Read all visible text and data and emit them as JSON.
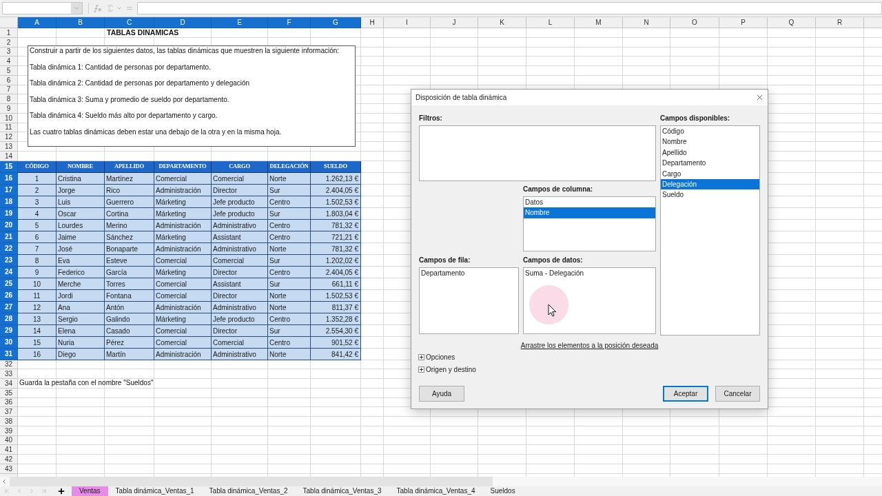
{
  "columns": [
    {
      "label": "A",
      "selected": true
    },
    {
      "label": "B",
      "selected": true
    },
    {
      "label": "C",
      "selected": true
    },
    {
      "label": "D",
      "selected": true
    },
    {
      "label": "E",
      "selected": true
    },
    {
      "label": "F",
      "selected": true
    },
    {
      "label": "G",
      "selected": true
    },
    {
      "label": "H",
      "selected": false
    },
    {
      "label": "I",
      "selected": false
    },
    {
      "label": "J",
      "selected": false
    },
    {
      "label": "K",
      "selected": false
    },
    {
      "label": "L",
      "selected": false
    },
    {
      "label": "M",
      "selected": false
    },
    {
      "label": "N",
      "selected": false
    },
    {
      "label": "O",
      "selected": false
    },
    {
      "label": "P",
      "selected": false
    },
    {
      "label": "Q",
      "selected": false
    },
    {
      "label": "R",
      "selected": false
    }
  ],
  "rows": [
    {
      "label": "1",
      "selected": false
    },
    {
      "label": "2",
      "selected": false
    },
    {
      "label": "3",
      "selected": false
    },
    {
      "label": "4",
      "selected": false
    },
    {
      "label": "5",
      "selected": false
    },
    {
      "label": "6",
      "selected": false
    },
    {
      "label": "7",
      "selected": false
    },
    {
      "label": "8",
      "selected": false
    },
    {
      "label": "9",
      "selected": false
    },
    {
      "label": "10",
      "selected": false
    },
    {
      "label": "11",
      "selected": false
    },
    {
      "label": "12",
      "selected": false
    },
    {
      "label": "13",
      "selected": false
    },
    {
      "label": "14",
      "selected": false
    },
    {
      "label": "15",
      "selected": true
    },
    {
      "label": "16",
      "selected": true
    },
    {
      "label": "17",
      "selected": true
    },
    {
      "label": "18",
      "selected": true
    },
    {
      "label": "19",
      "selected": true
    },
    {
      "label": "20",
      "selected": true
    },
    {
      "label": "21",
      "selected": true
    },
    {
      "label": "22",
      "selected": true
    },
    {
      "label": "23",
      "selected": true
    },
    {
      "label": "24",
      "selected": true
    },
    {
      "label": "25",
      "selected": true
    },
    {
      "label": "26",
      "selected": true
    },
    {
      "label": "27",
      "selected": true
    },
    {
      "label": "28",
      "selected": true
    },
    {
      "label": "29",
      "selected": true
    },
    {
      "label": "30",
      "selected": true
    },
    {
      "label": "31",
      "selected": true
    },
    {
      "label": "32",
      "selected": false
    },
    {
      "label": "33",
      "selected": false
    },
    {
      "label": "34",
      "selected": false
    },
    {
      "label": "35",
      "selected": false
    },
    {
      "label": "36",
      "selected": false
    },
    {
      "label": "37",
      "selected": false
    },
    {
      "label": "38",
      "selected": false
    },
    {
      "label": "39",
      "selected": false
    },
    {
      "label": "40",
      "selected": false
    },
    {
      "label": "41",
      "selected": false
    },
    {
      "label": "42",
      "selected": false
    },
    {
      "label": "43",
      "selected": false
    }
  ],
  "title": "TABLAS DINAMICAS",
  "instructions": [
    "Construir a partir de los siguientes datos, las tablas dinámicas que muestren la siguiente información:",
    "Tabla dinámica 1: Cantidad de personas por departamento.",
    "Tabla dinámica 2: Cantidad de personas por departamento y delegación",
    "Tabla dinámica 3:  Suma y promedio de sueldo por departamento.",
    "Tabla dinámica 4: Sueldo más alto por departamento y cargo.",
    "Las cuatro tablas dinámicas deben estar una debajo de la otra y en la misma hoja."
  ],
  "table": {
    "columns": [
      "CÓDIGO",
      "NOMBRE",
      "APELLIDO",
      "DEPARTAMENTO",
      "CARGO",
      "DELEGACIÓN",
      "SUELDO"
    ],
    "rows": [
      [
        "1",
        "Cristina",
        "Martínez",
        "Comercial",
        "Comercial",
        "Norte",
        "1.262,13 €"
      ],
      [
        "2",
        "Jorge",
        "Rico",
        "Administración",
        "Director",
        "Sur",
        "2.404,05 €"
      ],
      [
        "3",
        "Luis",
        "Guerrero",
        "Márketing",
        "Jefe producto",
        "Centro",
        "1.502,53 €"
      ],
      [
        "4",
        "Oscar",
        "Cortina",
        "Márketing",
        "Jefe producto",
        "Sur",
        "1.803,04 €"
      ],
      [
        "5",
        "Lourdes",
        "Merino",
        "Administración",
        "Administrativo",
        "Centro",
        "781,32 €"
      ],
      [
        "6",
        "Jaime",
        "Sánchez",
        "Márketing",
        "Assistant",
        "Centro",
        "721,21 €"
      ],
      [
        "7",
        "José",
        "Bonaparte",
        "Administración",
        "Administrativo",
        "Norte",
        "781,32 €"
      ],
      [
        "8",
        "Eva",
        "Esteve",
        "Comercial",
        "Comercial",
        "Sur",
        "1.202,02 €"
      ],
      [
        "9",
        "Federico",
        "García",
        "Márketing",
        "Director",
        "Centro",
        "2.404,05 €"
      ],
      [
        "10",
        "Merche",
        "Torres",
        "Comercial",
        "Assistant",
        "Sur",
        "661,11 €"
      ],
      [
        "11",
        "Jordi",
        "Fontana",
        "Comercial",
        "Director",
        "Norte",
        "1.502,53 €"
      ],
      [
        "12",
        "Ana",
        "Antón",
        "Administración",
        "Administrativo",
        "Norte",
        "811,37 €"
      ],
      [
        "13",
        "Sergio",
        "Galindo",
        "Márketing",
        "Jefe producto",
        "Centro",
        "1.352,28 €"
      ],
      [
        "14",
        "Elena",
        "Casado",
        "Comercial",
        "Director",
        "Sur",
        "2.554,30 €"
      ],
      [
        "15",
        "Nuria",
        "Pérez",
        "Comercial",
        "Comercial",
        "Centro",
        "901,52 €"
      ],
      [
        "16",
        "Diego",
        "Martín",
        "Administración",
        "Administrativo",
        "Norte",
        "841,42 €"
      ]
    ]
  },
  "note": "Guarda la pestaña con el nombre \"Sueldos\"",
  "sheet_tabs": [
    {
      "label": "Ventas",
      "selected": true
    },
    {
      "label": "Tabla dinámica_Ventas_1",
      "selected": false
    },
    {
      "label": "Tabla dinámica_Ventas_2",
      "selected": false
    },
    {
      "label": "Tabla dinámica_Ventas_3",
      "selected": false
    },
    {
      "label": "Tabla dinámica_Ventas_4",
      "selected": false
    },
    {
      "label": "Sueldos",
      "selected": false
    }
  ],
  "dialog": {
    "title": "Disposición de tabla dinámica",
    "filters": {
      "label": "Filtros:"
    },
    "available_fields": {
      "label": "Campos disponibles:",
      "items": [
        {
          "label": "Código",
          "selected": false
        },
        {
          "label": "Nombre",
          "selected": false
        },
        {
          "label": "Apellido",
          "selected": false
        },
        {
          "label": "Departamento",
          "selected": false
        },
        {
          "label": "Cargo",
          "selected": false
        },
        {
          "label": "Delegación",
          "selected": true
        },
        {
          "label": "Sueldo",
          "selected": false
        }
      ]
    },
    "column_fields": {
      "label": "Campos de columna:",
      "items": [
        {
          "label": "Datos",
          "selected": false
        },
        {
          "label": "Nombre",
          "selected": true
        }
      ]
    },
    "row_fields": {
      "label": "Campos de fila:",
      "items": [
        {
          "label": "Departamento",
          "selected": false
        }
      ]
    },
    "data_fields": {
      "label": "Campos de datos:",
      "items": [
        {
          "label": "Suma - Delegación",
          "selected": false
        }
      ]
    },
    "hint": "Arrastre los elementos a la posición deseada",
    "sections": [
      {
        "label": "Opciones",
        "expanded": false
      },
      {
        "label": "Origen y destino",
        "expanded": false
      }
    ],
    "buttons": [
      {
        "label": "Ayuda",
        "default": false
      },
      {
        "label": "Aceptar",
        "default": true
      },
      {
        "label": "Cancelar",
        "default": false
      }
    ]
  }
}
